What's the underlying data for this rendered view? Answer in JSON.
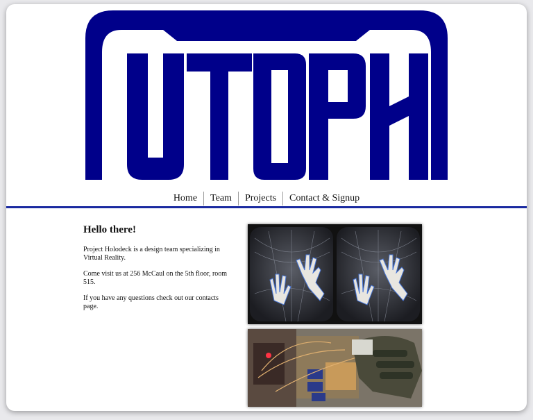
{
  "logo": {
    "text": "UTOPH",
    "color": "#00008a"
  },
  "nav": {
    "items": [
      {
        "label": "Home"
      },
      {
        "label": "Team"
      },
      {
        "label": "Projects"
      },
      {
        "label": "Contact & Signup"
      }
    ]
  },
  "accent_color": "#1a2aa0",
  "main": {
    "heading": "Hello there!",
    "paragraphs": [
      "Project Holodeck is a design team specializing in Virtual Reality.",
      "Come visit us at 256 McCaul on the 5th floor, room 515.",
      "If you have any questions check out our contacts page."
    ]
  },
  "images": [
    {
      "subject": "vr-hands-stereo-view"
    },
    {
      "subject": "hardware-glove-prototype"
    }
  ]
}
